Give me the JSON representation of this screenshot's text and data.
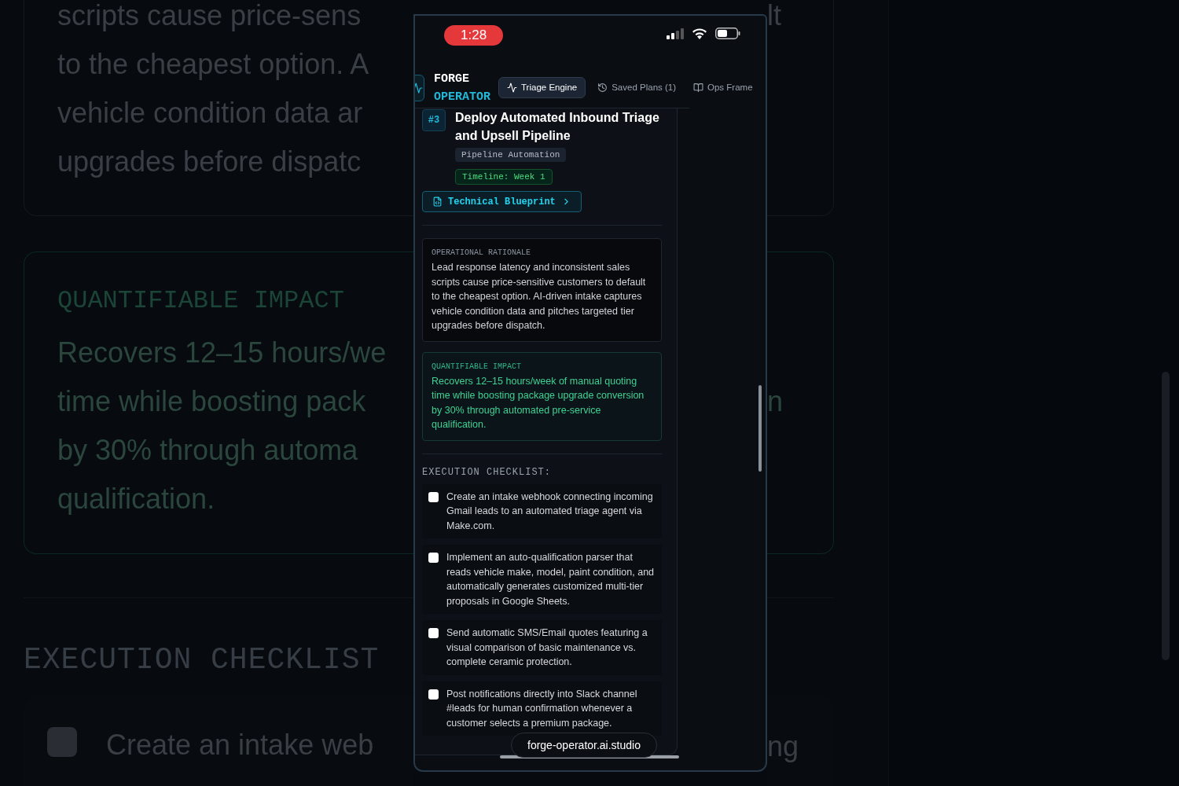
{
  "background": {
    "rationale_lines": [
      "scripts cause price-sens",
      "to the cheapest option. A",
      "vehicle condition data ar",
      "upgrades before dispatc"
    ],
    "impact_label": "QUANTIFIABLE IMPACT",
    "impact_lines": [
      "Recovers 12–15 hours/we",
      "time while boosting pack",
      "by 30% through automa",
      "qualification."
    ],
    "checklist_label": "EXECUTION CHECKLIST",
    "first_item": {
      "text": "Create an intake web",
      "checked": false
    },
    "right_fragments": [
      "lt",
      "n",
      "ng"
    ]
  },
  "phone": {
    "status": {
      "time": "1:28"
    },
    "brand": {
      "line1": "FORGE",
      "line2": "OPERATOR"
    },
    "tabs": [
      {
        "label": "Triage Engine",
        "kind": "activity",
        "selected": true
      },
      {
        "label": "Saved Plans (1)",
        "kind": "history",
        "selected": false
      },
      {
        "label": "Ops Frame",
        "kind": "book",
        "selected": false
      }
    ],
    "plan": {
      "number": "#3",
      "title": "Deploy Automated Inbound Triage and Upsell Pipeline",
      "category": "Pipeline Automation",
      "timeline": "Timeline: Week 1",
      "blueprint_button": "Technical Blueprint",
      "rationale": {
        "label": "OPERATIONAL RATIONALE",
        "text": "Lead response latency and inconsistent sales scripts cause price-sensitive customers to default to the cheapest option. AI-driven intake captures vehicle condition data and pitches targeted tier upgrades before dispatch."
      },
      "impact": {
        "label": "QUANTIFIABLE IMPACT",
        "text": "Recovers 12–15 hours/week of manual quoting time while boosting package upgrade conversion by 30% through automated pre-service qualification."
      },
      "checklist_label": "EXECUTION CHECKLIST:",
      "checklist": [
        {
          "text": "Create an intake webhook connecting incoming Gmail leads to an automated triage agent via Make.com.",
          "checked": false
        },
        {
          "text": "Implement an auto-qualification parser that reads vehicle make, model, paint condition, and automatically generates customized multi-tier proposals in Google Sheets.",
          "checked": false
        },
        {
          "text": "Send automatic SMS/Email quotes featuring a visual comparison of basic maintenance vs. complete ceramic protection.",
          "checked": false
        },
        {
          "text": "Post notifications directly into Slack channel #leads for human confirmation whenever a customer selects a premium package.",
          "checked": false
        }
      ]
    },
    "url": "forge-operator.ai.studio"
  }
}
